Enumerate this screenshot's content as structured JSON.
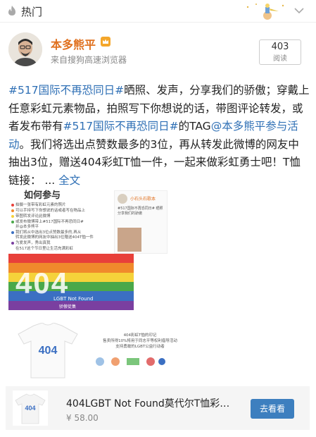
{
  "topbar": {
    "tab_label": "热门"
  },
  "post": {
    "username": "本多熊平",
    "source": "来自搜狗高速浏览器",
    "views": {
      "count": "403",
      "label": "阅读"
    },
    "text": {
      "hashtag1": "#517国际不再恐同日#",
      "part1": "晒照、发声，分享我们的骄傲；穿戴上任意彩虹元素物品，拍照写下你想说的话，带图评论转发，或者发布带有",
      "hashtag2": "#517国际不再恐同日#",
      "part2": "的TAG",
      "mention": "@本多熊平参与活动",
      "part3": "。我们将选出点赞数最多的3位，再从转发此微博的网友中抽出3位，赠送404彩虹T恤一件，一起来做彩虹勇士吧！T恤链接：",
      "ellipsis": " ... ",
      "expand": "全文"
    }
  },
  "image": {
    "howto": {
      "title": "如何参与",
      "lines": [
        "拍摄一张带有彩虹元素的照片",
        "可以手持写下你想说的话或者写在物品上",
        "带图转发评论此微博",
        "或发布微博带上#517国际不再恐同日#",
        "并@本多熊平",
        "我们将从中选出3位点赞数最多的,再从",
        "转发此微博的网友中抽出3位赠送404T恤一件",
        "为爱发声，秀出真我",
        "在517这个节日里让生活充满彩虹"
      ]
    },
    "weibo_card": {
      "name": "小石头石歌本",
      "text": "#517国际不再恐同日# 晒照 分享我们的骄傲"
    },
    "flag": {
      "big": "404",
      "sub1": "LGBT Not Found",
      "sub2": "骄傲徒集",
      "colors": [
        "#e8403a",
        "#f08a2c",
        "#f5d23a",
        "#4aa84a",
        "#3b6fc2",
        "#7a3fa0"
      ]
    },
    "shirt_text": {
      "line1": "404彩虹T恤的印记",
      "line2": "售卖所得10%将用于同志平等权利倡导活动",
      "line3": "支持勇敢的LGBT公益行动者"
    },
    "shirt_print": "404"
  },
  "product": {
    "name": "404LGBT Not Found莫代尔T恤彩…",
    "price": "¥ 58.00",
    "button": "去看看",
    "thumb_print": "404"
  }
}
